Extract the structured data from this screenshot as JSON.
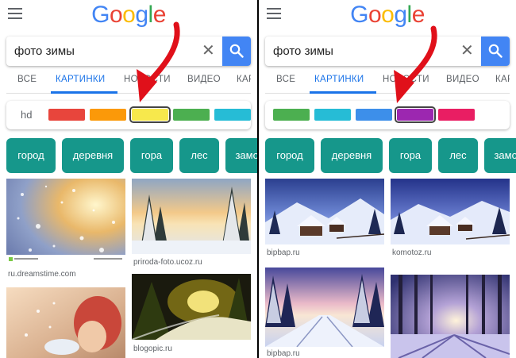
{
  "colors": {
    "google_blue": "#4285f4",
    "google_red": "#ea4335",
    "google_yellow": "#fbbc05",
    "google_green": "#34a853",
    "chip_teal": "#16978b",
    "tab_active": "#1a73e8",
    "arrow_red": "#e0101a"
  },
  "logo": {
    "letters": [
      "G",
      "o",
      "o",
      "g",
      "l",
      "e"
    ]
  },
  "left": {
    "search": {
      "query": "фото зимы",
      "clear_icon": "close-icon",
      "search_icon": "search-icon"
    },
    "tabs": [
      "ВСЕ",
      "КАРТИНКИ",
      "НОВОСТИ",
      "ВИДЕО",
      "КАРТЫ"
    ],
    "active_tab": "КАРТИНКИ",
    "filter": {
      "hd_label": "hd",
      "swatches": [
        "#e8453c",
        "#fb9909",
        "#f7e84c",
        "#4caf50",
        "#26bcd6"
      ],
      "selected": "#f7e84c"
    },
    "chips": [
      "город",
      "деревня",
      "гора",
      "лес",
      "замок"
    ],
    "images": [
      {
        "caption": "ru.dreamstime.com",
        "source_hint": "snowflakes bokeh"
      },
      {
        "caption": "priroda-foto.ucoz.ru",
        "source_hint": "snowy forest sunset"
      },
      {
        "caption": "",
        "source_hint": "person blowing snow"
      },
      {
        "caption": "blogopic.ru",
        "source_hint": "night snowy road lights"
      }
    ]
  },
  "right": {
    "search": {
      "query": "фото зимы",
      "clear_icon": "close-icon",
      "search_icon": "search-icon"
    },
    "tabs": [
      "ВСЕ",
      "КАРТИНКИ",
      "НОВОСТИ",
      "ВИДЕО",
      "КАРТЫ"
    ],
    "active_tab": "КАРТИНКИ",
    "filter": {
      "swatches": [
        "#4caf50",
        "#26bcd6",
        "#3d8fea",
        "#9c27b0",
        "#e91e63"
      ],
      "selected": "#9c27b0"
    },
    "chips": [
      "город",
      "деревня",
      "гора",
      "лес",
      "замок"
    ],
    "images": [
      {
        "caption": "bipbap.ru",
        "source_hint": "snowy cabins blue sky"
      },
      {
        "caption": "komotoz.ru",
        "source_hint": "snowy cabins dusk"
      },
      {
        "caption": "bipbap.ru",
        "source_hint": "snowy forest path sunrise"
      },
      {
        "caption": "",
        "source_hint": "winter forest sunset shadows"
      }
    ]
  }
}
